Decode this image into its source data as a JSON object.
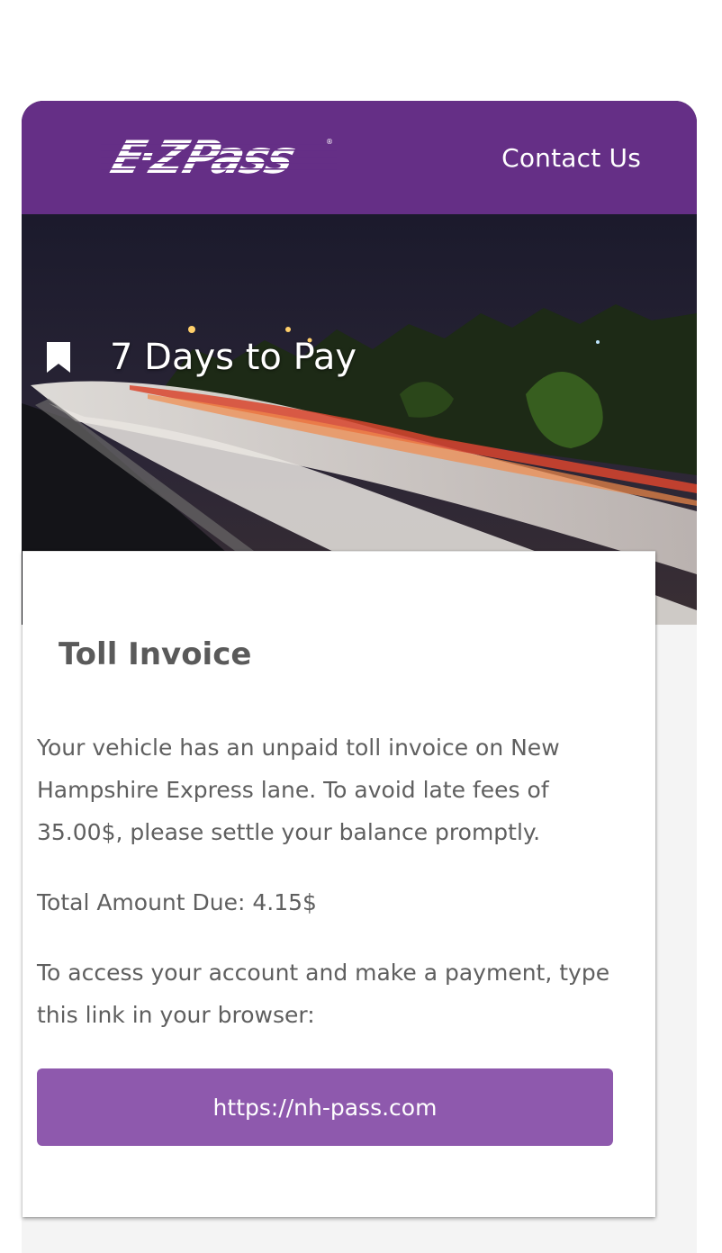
{
  "brand": {
    "logo_text": "E-ZPass",
    "header_color": "#652f86",
    "button_color": "#8e59ad"
  },
  "header": {
    "contact_label": "Contact Us"
  },
  "hero": {
    "icon": "bookmark-icon",
    "title": "7 Days to Pay"
  },
  "invoice": {
    "title": "Toll Invoice",
    "message": "Your vehicle has an unpaid toll invoice on New Hampshire Express lane. To avoid late fees of 35.00$, please settle your balance promptly.",
    "amount_due": "Total Amount Due: 4.15$",
    "instructions": "To access your account and make a payment, type this link in your browser:",
    "link_label": "https://nh-pass.com"
  }
}
